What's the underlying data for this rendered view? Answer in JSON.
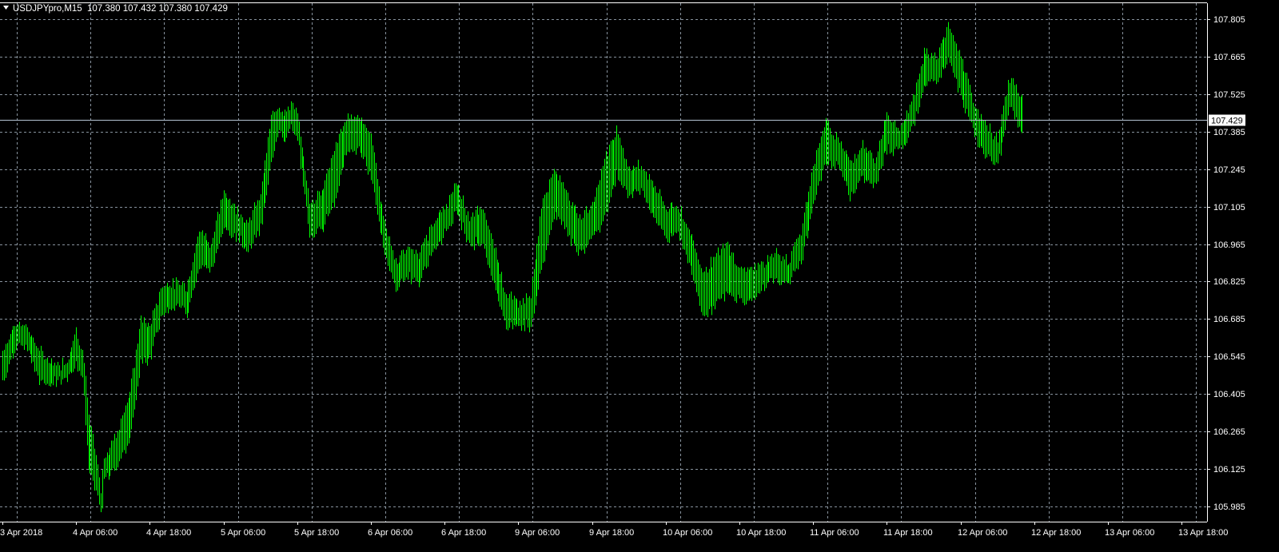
{
  "header": {
    "symbol_timeframe": "USDJPYpro,M15",
    "ohlc": "107.380 107.432 107.380 107.429"
  },
  "colors": {
    "background": "#000000",
    "bars": "#00ff00",
    "grid": "#b4c3d2",
    "axis": "#ffffff",
    "price_line": "#b4c3d2",
    "price_tag_bg": "#ffffff"
  },
  "price_tag": "107.429",
  "chart_data": {
    "type": "line",
    "subtype": "ohlc-bars",
    "symbol": "USDJPYpro",
    "timeframe": "M15",
    "grid": true,
    "y_axis_position": "right",
    "ylim": [
      105.96,
      107.85
    ],
    "y_ticks": [
      "107.805",
      "107.665",
      "107.525",
      "107.385",
      "107.245",
      "107.105",
      "106.965",
      "106.825",
      "106.685",
      "106.545",
      "106.405",
      "106.265",
      "106.125",
      "105.985"
    ],
    "x_ticks": [
      "3 Apr 2018",
      "4 Apr 06:00",
      "4 Apr 18:00",
      "5 Apr 06:00",
      "5 Apr 18:00",
      "6 Apr 06:00",
      "6 Apr 18:00",
      "9 Apr 06:00",
      "9 Apr 18:00",
      "10 Apr 06:00",
      "10 Apr 18:00",
      "11 Apr 06:00",
      "11 Apr 18:00",
      "12 Apr 06:00",
      "12 Apr 18:00",
      "13 Apr 06:00",
      "13 Apr 18:00"
    ],
    "bars_per_tick": 48,
    "current_price": 107.429,
    "series": [
      {
        "time_offset_bars": [
          0,
          8,
          16,
          24,
          36,
          42,
          48,
          52,
          56,
          60,
          64,
          66,
          68,
          76,
          84,
          90,
          96,
          104,
          112,
          120,
          128,
          136,
          144,
          152,
          160,
          168,
          176,
          180,
          184,
          188,
          192,
          200,
          208,
          216,
          224,
          232,
          240,
          248,
          256,
          264,
          272,
          280,
          288,
          296,
          304,
          312,
          320,
          328,
          336,
          344,
          352,
          360,
          368,
          376,
          384,
          392,
          400,
          408,
          416,
          424,
          432,
          440,
          448,
          456,
          464,
          472,
          480,
          488,
          496,
          504,
          512,
          520,
          528,
          536,
          544,
          552,
          560,
          568,
          576,
          584,
          592,
          600,
          608,
          616,
          624,
          632,
          640,
          648,
          656,
          664,
          672,
          680,
          688,
          696,
          704,
          712,
          720,
          728,
          736,
          744,
          752,
          760,
          768,
          776,
          784,
          792,
          800,
          808,
          816
        ],
        "close": [
          106.5,
          106.64,
          106.62,
          106.52,
          106.47,
          106.5,
          106.58,
          106.52,
          106.25,
          106.15,
          106.0,
          106.13,
          106.12,
          106.2,
          106.3,
          106.62,
          106.6,
          106.75,
          106.78,
          106.73,
          106.96,
          106.9,
          107.12,
          107.05,
          106.97,
          107.08,
          107.4,
          107.45,
          107.38,
          107.45,
          107.4,
          107.05,
          107.1,
          107.25,
          107.4,
          107.4,
          107.3,
          107.0,
          106.85,
          106.9,
          106.85,
          107.0,
          107.05,
          107.15,
          107.0,
          107.05,
          106.9,
          106.72,
          106.7,
          106.72,
          107.0,
          107.2,
          107.08,
          107.0,
          107.05,
          107.15,
          107.35,
          107.2,
          107.22,
          107.15,
          107.05,
          107.08,
          106.95,
          106.75,
          106.85,
          106.85,
          106.8,
          106.82,
          106.85,
          106.88,
          106.85,
          106.95,
          107.15,
          107.4,
          107.3,
          107.22,
          107.27,
          107.22,
          107.4,
          107.35,
          107.42,
          107.65,
          107.62,
          107.75,
          107.6,
          107.45,
          107.35,
          107.3,
          107.55,
          107.43
        ],
        "high": [
          106.6,
          106.67,
          106.66,
          106.58,
          106.52,
          106.54,
          106.68,
          106.6,
          106.35,
          106.25,
          106.05,
          106.18,
          106.2,
          106.35,
          106.55,
          106.72,
          106.69,
          106.85,
          106.83,
          106.85,
          107.05,
          107.0,
          107.18,
          107.12,
          107.08,
          107.2,
          107.5,
          107.5,
          107.48,
          107.5,
          107.46,
          107.15,
          107.22,
          107.35,
          107.45,
          107.45,
          107.43,
          107.1,
          106.92,
          106.97,
          106.97,
          107.07,
          107.12,
          107.2,
          107.1,
          107.12,
          107.0,
          106.8,
          106.77,
          106.8,
          107.25,
          107.25,
          107.2,
          107.12,
          107.12,
          107.4,
          107.4,
          107.27,
          107.27,
          107.2,
          107.12,
          107.12,
          107.03,
          106.95,
          106.95,
          107.05,
          106.92,
          106.9,
          106.92,
          106.95,
          106.92,
          107.05,
          107.35,
          107.42,
          107.4,
          107.3,
          107.38,
          107.3,
          107.5,
          107.4,
          107.55,
          107.68,
          107.68,
          107.78,
          107.7,
          107.52,
          107.45,
          107.38,
          107.6,
          107.55
        ],
        "low": [
          106.42,
          106.55,
          106.55,
          106.42,
          106.45,
          106.46,
          106.48,
          106.45,
          106.05,
          106.0,
          105.99,
          106.05,
          106.08,
          106.12,
          106.25,
          106.45,
          106.5,
          106.68,
          106.72,
          106.7,
          106.83,
          106.85,
          106.98,
          106.96,
          106.93,
          107.0,
          107.2,
          107.38,
          107.32,
          107.38,
          107.35,
          106.97,
          106.98,
          107.0,
          107.25,
          107.28,
          107.15,
          106.92,
          106.78,
          106.81,
          106.83,
          106.9,
          106.98,
          107.05,
          106.95,
          106.92,
          106.75,
          106.62,
          106.65,
          106.62,
          106.82,
          107.0,
          106.95,
          106.9,
          106.92,
          107.0,
          107.12,
          107.12,
          107.15,
          107.0,
          106.95,
          106.98,
          106.82,
          106.67,
          106.65,
          106.75,
          106.75,
          106.7,
          106.8,
          106.82,
          106.82,
          106.88,
          107.1,
          107.18,
          107.25,
          107.1,
          107.18,
          107.18,
          107.27,
          107.32,
          107.38,
          107.48,
          107.55,
          107.6,
          107.45,
          107.35,
          107.28,
          107.24,
          107.42,
          107.37
        ]
      }
    ]
  }
}
